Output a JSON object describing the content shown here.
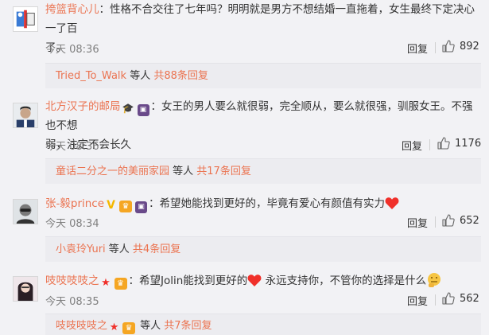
{
  "comments": [
    {
      "username": "挎篮背心儿",
      "text_line1": "：性格不合交往了七年吗？明明就是男方不想结婚一直拖着，女生最终下定决心一了百",
      "text_line2": "了。",
      "time": "今天 08:36",
      "reply_label": "回复",
      "likes": "892",
      "sub_user": "Tried_To_Walk",
      "sub_mid": " 等人 ",
      "sub_count": "共88条回复"
    },
    {
      "username": "北方汉子的邮局",
      "text_line1": "：女王的男人要么就很弱，完全顺从，要么就很强，驯服女王。不强也不想",
      "text_line2": "弱，注定不会长久",
      "time": "今天 08:36",
      "reply_label": "回复",
      "likes": "1176",
      "sub_user": "童话二分之一的美丽家园",
      "sub_mid": " 等人 ",
      "sub_count": "共17条回复"
    },
    {
      "username": "张-毅prince",
      "text_line1": "：希望她能找到更好的，毕竟有爱心有颜值有实力",
      "time": "今天 08:34",
      "reply_label": "回复",
      "likes": "652",
      "sub_user": "小袁玲Yuri",
      "sub_mid": " 等人 ",
      "sub_count": "共4条回复"
    },
    {
      "username": "吱吱吱吱之",
      "text_before": "：希望Jolin能找到更好的",
      "text_mid": " 永远支持你，不管你的选择是什么",
      "time": "今天 08:35",
      "reply_label": "回复",
      "likes": "562",
      "sub_user": "吱吱吱吱之",
      "sub_mid": " 等人 ",
      "sub_count": "共7条回复"
    }
  ],
  "colors": {
    "accent": "#eb7350",
    "background": "#f2f2f5",
    "meta": "#808080",
    "heart": "#f0302a"
  }
}
